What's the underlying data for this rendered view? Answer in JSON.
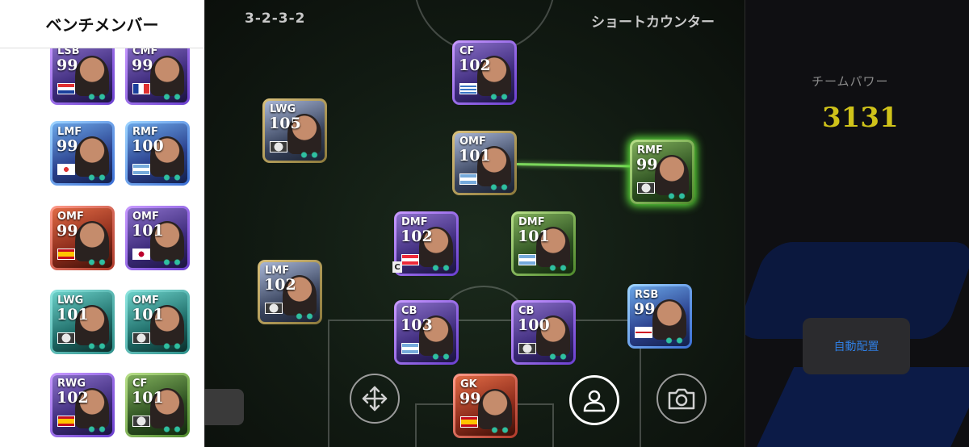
{
  "bench": {
    "title": "ベンチメンバー",
    "players": [
      {
        "pos": "LSB",
        "rating": "99",
        "rarity": "purple",
        "flag": "croatia"
      },
      {
        "pos": "CMF",
        "rating": "99",
        "rarity": "purple",
        "flag": "france"
      },
      {
        "pos": "LMF",
        "rating": "99",
        "rarity": "blue",
        "flag": "south-korea"
      },
      {
        "pos": "RMF",
        "rating": "100",
        "rarity": "blue",
        "flag": "argentina"
      },
      {
        "pos": "OMF",
        "rating": "99",
        "rarity": "red",
        "flag": "spain"
      },
      {
        "pos": "OMF",
        "rating": "101",
        "rarity": "purple",
        "flag": "japan"
      },
      {
        "pos": "LWG",
        "rating": "101",
        "rarity": "teal",
        "flag": "club"
      },
      {
        "pos": "OMF",
        "rating": "101",
        "rarity": "teal",
        "flag": "club"
      },
      {
        "pos": "RWG",
        "rating": "102",
        "rarity": "purple",
        "flag": "spain"
      },
      {
        "pos": "CF",
        "rating": "101",
        "rarity": "green",
        "flag": "club"
      }
    ]
  },
  "field": {
    "formation": "3-2-3-2",
    "tactic": "ショートカウンター",
    "players": [
      {
        "pos": "CF",
        "rating": "102",
        "rarity": "purple",
        "flag": "uruguay"
      },
      {
        "pos": "LWG",
        "rating": "105",
        "rarity": "gold",
        "flag": "club"
      },
      {
        "pos": "OMF",
        "rating": "101",
        "rarity": "gold",
        "flag": "argentina"
      },
      {
        "pos": "RMF",
        "rating": "99",
        "rarity": "green",
        "flag": "club",
        "selected": true
      },
      {
        "pos": "DMF",
        "rating": "102",
        "rarity": "purple",
        "flag": "austria",
        "captain": "C"
      },
      {
        "pos": "DMF",
        "rating": "101",
        "rarity": "green",
        "flag": "argentina"
      },
      {
        "pos": "LMF",
        "rating": "102",
        "rarity": "gold",
        "flag": "club"
      },
      {
        "pos": "RSB",
        "rating": "99",
        "rarity": "blue",
        "flag": "england"
      },
      {
        "pos": "CB",
        "rating": "103",
        "rarity": "purple",
        "flag": "argentina"
      },
      {
        "pos": "CB",
        "rating": "100",
        "rarity": "purple",
        "flag": "club"
      },
      {
        "pos": "GK",
        "rating": "99",
        "rarity": "red",
        "flag": "spain"
      }
    ]
  },
  "team_power": {
    "label": "チームパワー",
    "value": "3131"
  },
  "auto_button": {
    "label": "自動配置"
  },
  "controls": [
    {
      "name": "move-icon"
    },
    {
      "name": "person-icon",
      "active": true
    },
    {
      "name": "camera-icon"
    }
  ],
  "colors": {
    "team_power": "#cfc21a",
    "auto_button_text": "#2f7de0",
    "link_line": "#7bd65b"
  }
}
